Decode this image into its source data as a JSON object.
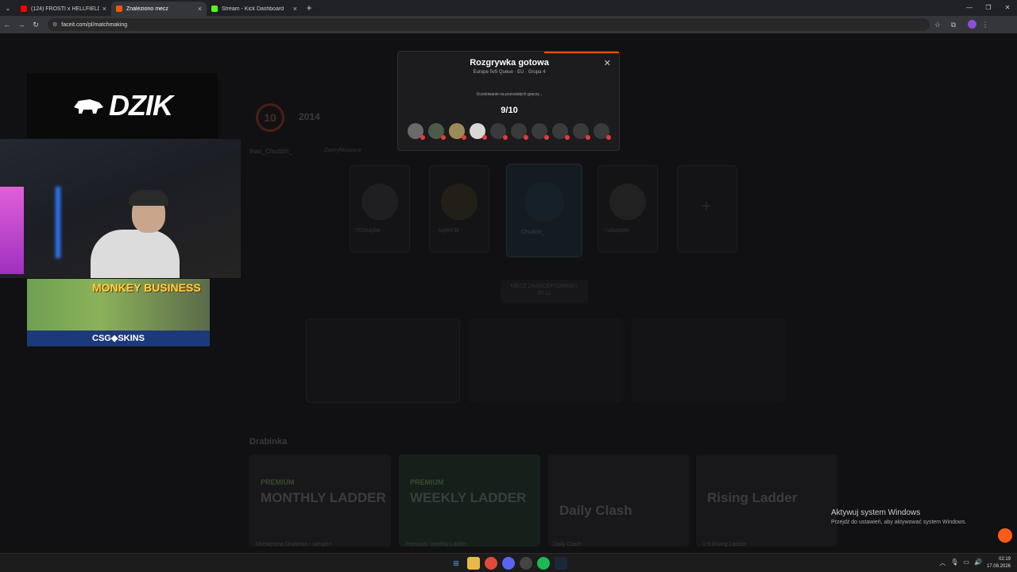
{
  "browser": {
    "tabs": [
      {
        "label": "(124) FROSTI x HELLFIELD - WS",
        "color": "#ff0000",
        "active": false
      },
      {
        "label": "Znaleziono mecz",
        "color": "#ff5500",
        "active": true
      },
      {
        "label": "Stream - Kick Dashboard",
        "color": "#53fc18",
        "active": false
      }
    ],
    "url": "faceit.com/pl/matchmaking"
  },
  "modal": {
    "title": "Rozgrywka gotowa",
    "subtitle": "Europe 5v5 Queue · EU · Grupa 4",
    "waiting": "Oczekiwanie na pozostałych graczy...",
    "count": "9/10",
    "players_accepted": 4,
    "players_total": 10
  },
  "background": {
    "level": "10",
    "elo": "2014",
    "username": "Inan_Chudzin_",
    "verified": "Zweryfikowane",
    "team": [
      "7O0kaybe",
      "Aajtek3k",
      "Chudzin_",
      "rudazpole"
    ],
    "match_status": "MECZ ZAAKCEPTOWANY",
    "timer": "00:12",
    "ladder_title": "Drabinka",
    "ladders": [
      {
        "small": "PREMIUM",
        "big": "MONTHLY LADDER",
        "caption": "Miesięczna Drabinka - sierpień"
      },
      {
        "small": "PREMIUM",
        "big": "WEEKLY LADDER",
        "caption": "Premium: Weekly Ladder"
      },
      {
        "small": "",
        "big": "Daily Clash",
        "caption": "Daily Clash"
      },
      {
        "small": "",
        "big": "Rising Ladder",
        "caption": "1-5 Rising Ladder"
      }
    ]
  },
  "overlay": {
    "brand": "DZIK",
    "banner_title": "MONKEY BUSINESS",
    "banner_sponsor": "CSG◆SKINS"
  },
  "windows": {
    "activate_title": "Aktywuj system Windows",
    "activate_sub": "Przejdź do ustawień, aby aktywować system Windows.",
    "time": "02:19",
    "date": "17.08.2026"
  }
}
